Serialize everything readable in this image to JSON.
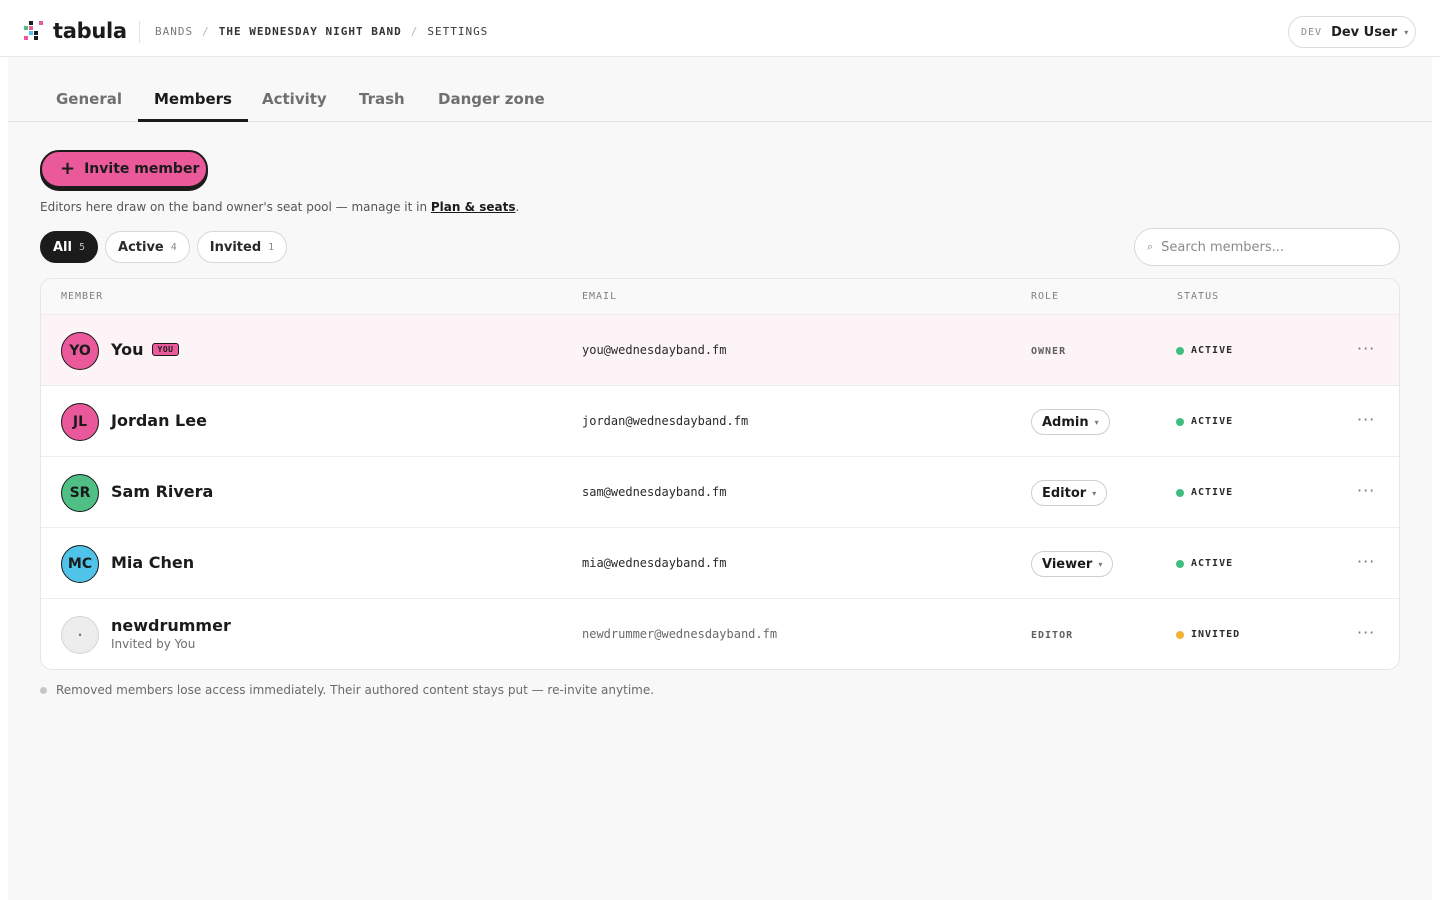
{
  "app": {
    "name": "tabula"
  },
  "breadcrumb": {
    "items": [
      "BANDS",
      "THE WEDNESDAY NIGHT BAND",
      "SETTINGS"
    ],
    "separator": "/"
  },
  "user": {
    "env_tag": "DEV",
    "name": "Dev User"
  },
  "tabs": [
    {
      "label": "General"
    },
    {
      "label": "Members"
    },
    {
      "label": "Activity"
    },
    {
      "label": "Trash"
    },
    {
      "label": "Danger zone"
    }
  ],
  "active_tab": "Members",
  "invite_button": {
    "icon": "+",
    "label": "Invite member"
  },
  "note": {
    "text": "Editors here draw on the band owner's seat pool — manage it in ",
    "link": "Plan & seats",
    "end": "."
  },
  "filters": [
    {
      "label": "All",
      "count": "5"
    },
    {
      "label": "Active",
      "count": "4"
    },
    {
      "label": "Invited",
      "count": "1"
    }
  ],
  "search": {
    "placeholder": "Search members..."
  },
  "table": {
    "headers": {
      "member": "MEMBER",
      "email": "EMAIL",
      "role": "ROLE",
      "status": "STATUS"
    },
    "rows": [
      {
        "initials": "YO",
        "name": "You",
        "badge": "YOU",
        "email": "you@wednesdayband.fm",
        "role": "OWNER",
        "status": "ACTIVE"
      },
      {
        "initials": "JL",
        "name": "Jordan Lee",
        "email": "jordan@wednesdayband.fm",
        "role": "Admin",
        "status": "ACTIVE"
      },
      {
        "initials": "SR",
        "name": "Sam Rivera",
        "email": "sam@wednesdayband.fm",
        "role": "Editor",
        "status": "ACTIVE"
      },
      {
        "initials": "MC",
        "name": "Mia Chen",
        "email": "mia@wednesdayband.fm",
        "role": "Viewer",
        "status": "ACTIVE"
      },
      {
        "initials": "·",
        "name": "newdrummer",
        "sub": "Invited by You",
        "email": "newdrummer@wednesdayband.fm",
        "role": "EDITOR",
        "status": "INVITED"
      }
    ],
    "more_icon": "···"
  },
  "footnote": "Removed members lose access immediately. Their authored content stays put — re-invite anytime.",
  "colors": {
    "accent_pink": "#ea5a9a",
    "avatar_jl": "#e8589a",
    "avatar_sr": "#4fbf86",
    "avatar_mc": "#4fc3ea",
    "status_active": "#3fbf7f",
    "status_invited": "#f3b236"
  },
  "icons": {
    "search": "search-icon",
    "caret": "chevron-down-icon",
    "more": "more-icon"
  }
}
